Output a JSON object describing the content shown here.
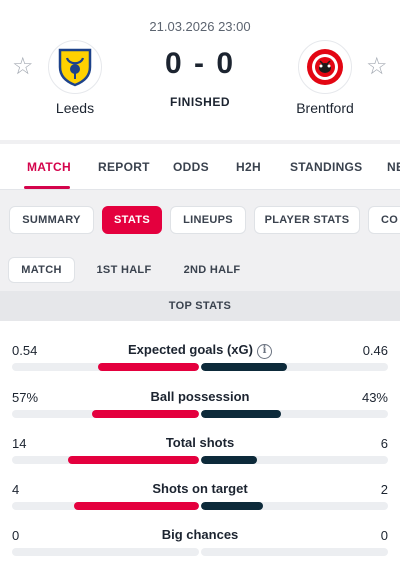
{
  "match": {
    "datetime": "21.03.2026 23:00",
    "score": "0 - 0",
    "status": "FINISHED",
    "home_team": "Leeds",
    "away_team": "Brentford"
  },
  "main_tabs": [
    "MATCH",
    "REPORT",
    "ODDS",
    "H2H",
    "STANDINGS",
    "NE"
  ],
  "sub_tabs": [
    "SUMMARY",
    "STATS",
    "LINEUPS",
    "PLAYER STATS",
    "CO"
  ],
  "periods": [
    "MATCH",
    "1ST HALF",
    "2ND HALF"
  ],
  "section_title": "TOP STATS",
  "stats": [
    {
      "label": "Expected goals (xG)",
      "home": "0.54",
      "away": "0.46",
      "home_frac": 0.54,
      "away_frac": 0.46,
      "info": true
    },
    {
      "label": "Ball possession",
      "home": "57%",
      "away": "43%",
      "home_frac": 0.57,
      "away_frac": 0.43,
      "info": false
    },
    {
      "label": "Total shots",
      "home": "14",
      "away": "6",
      "home_frac": 0.7,
      "away_frac": 0.3,
      "info": false
    },
    {
      "label": "Shots on target",
      "home": "4",
      "away": "2",
      "home_frac": 0.67,
      "away_frac": 0.33,
      "info": false
    },
    {
      "label": "Big chances",
      "home": "0",
      "away": "0",
      "home_frac": 0,
      "away_frac": 0,
      "info": false
    }
  ],
  "colors": {
    "accent": "#e4003e",
    "home_bar": "#e4003e",
    "away_bar": "#0d2a3a"
  },
  "icons": {
    "favorite": "star-outline-icon",
    "info": "info-icon"
  }
}
